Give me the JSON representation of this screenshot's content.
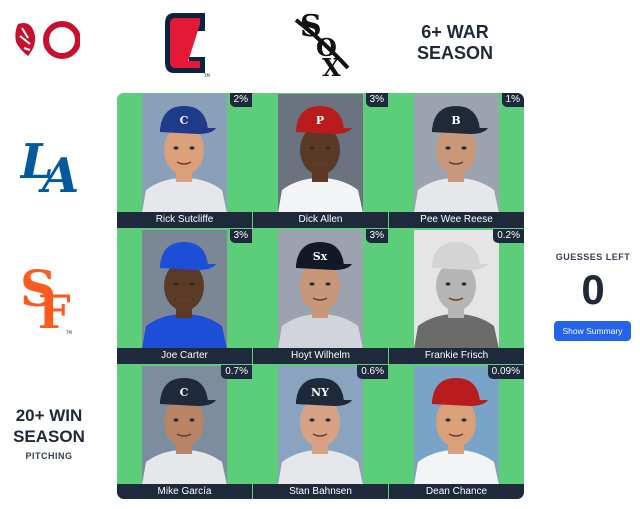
{
  "header": {
    "category_title_line1": "6+ WAR",
    "category_title_line2": "SEASON"
  },
  "logos": {
    "top_left": "reds-wishbone-c-logo",
    "col1": "cleveland-c-logo",
    "col2": "white-sox-logo",
    "row1": "dodgers-la-logo",
    "row2": "giants-sf-logo"
  },
  "row3_header": {
    "line1": "20+ WIN",
    "line2": "SEASON",
    "sub": "PITCHING"
  },
  "grid": {
    "cells": [
      {
        "name": "Rick Sutcliffe",
        "pct": "2%",
        "cap": "#1e3a8a",
        "cap_logo": "C",
        "skin": "#d9a07a",
        "shirt": "#e5e7eb",
        "bg": "#8aa0b8"
      },
      {
        "name": "Dick Allen",
        "pct": "3%",
        "cap": "#b91c1c",
        "cap_logo": "P",
        "skin": "#5a3a26",
        "shirt": "#f3f4f6",
        "bg": "#6b7280"
      },
      {
        "name": "Pee Wee Reese",
        "pct": "1%",
        "cap": "#1f2937",
        "cap_logo": "B",
        "skin": "#c99779",
        "shirt": "#e5e7eb",
        "bg": "#9ca3af"
      },
      {
        "name": "Joe Carter",
        "pct": "3%",
        "cap": "#1d4ed8",
        "cap_logo": "",
        "skin": "#5b3a28",
        "shirt": "#1d4ed8",
        "bg": "#7b8794"
      },
      {
        "name": "Hoyt Wilhelm",
        "pct": "3%",
        "cap": "#111827",
        "cap_logo": "Sx",
        "skin": "#c8977a",
        "shirt": "#d1d5db",
        "bg": "#9ca3af"
      },
      {
        "name": "Frankie Frisch",
        "pct": "0.2%",
        "cap": "#d4d4d4",
        "cap_logo": "",
        "skin": "#b5b5b5",
        "shirt": "#6b6b6b",
        "bg": "#e5e5e5"
      },
      {
        "name": "Mike García",
        "pct": "0.7%",
        "cap": "#1e293b",
        "cap_logo": "C",
        "skin": "#b98366",
        "shirt": "#e5e7eb",
        "bg": "#7c8da0"
      },
      {
        "name": "Stan Bahnsen",
        "pct": "0.6%",
        "cap": "#1e293b",
        "cap_logo": "NY",
        "skin": "#d6a283",
        "shirt": "#e5e7eb",
        "bg": "#8aa4c0"
      },
      {
        "name": "Dean Chance",
        "pct": "0.09%",
        "cap": "#b91c1c",
        "cap_logo": "",
        "skin": "#d9a07a",
        "shirt": "#f3f4f6",
        "bg": "#7aa3c8"
      }
    ]
  },
  "status": {
    "guesses_label": "GUESSES LEFT",
    "guesses_count": "0",
    "summary_button": "Show Summary"
  }
}
